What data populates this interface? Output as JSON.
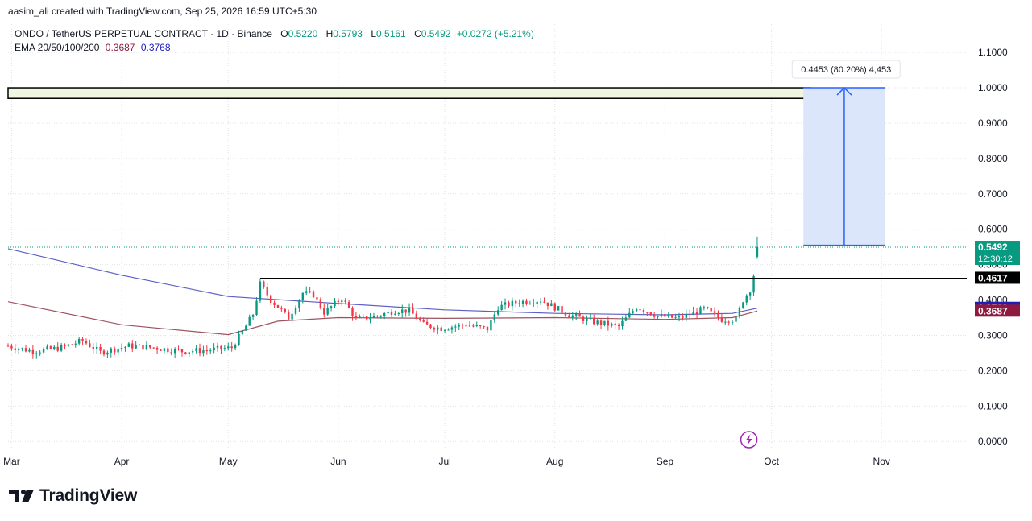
{
  "header": {
    "credit": "aasim_ali created with TradingView.com, Sep 25, 2026 16:59 UTC+5:30"
  },
  "legend": {
    "symbol": "ONDO / TetherUS PERPETUAL CONTRACT · 1D · Binance",
    "open_label": "O",
    "open": "0.5220",
    "high_label": "H",
    "high": "0.5793",
    "low_label": "L",
    "low": "0.5161",
    "close_label": "C",
    "close": "0.5492",
    "change": "+0.0272 (+5.21%)",
    "ema_label": "EMA 20/50/100/200",
    "ema1": "0.3687",
    "ema2": "0.3768"
  },
  "brand": {
    "name": "TradingView"
  },
  "colors": {
    "up": "#089981",
    "down": "#f23645",
    "ema_blue": "#5b5fc7",
    "ema_maroon": "#9c5461",
    "measure_fill": "#dbe6fb",
    "measure_line": "#2962ff",
    "zone_fill": "#eff7e1",
    "grid": "#e0e3eb"
  },
  "chart_data": {
    "type": "candlestick",
    "symbol": "ONDO / TetherUS PERPETUAL CONTRACT",
    "interval": "1D",
    "exchange": "Binance",
    "y_axis_side": "right",
    "ylim": [
      -0.02,
      1.18
    ],
    "y_ticks": [
      "1.1000",
      "1.0000",
      "0.9000",
      "0.8000",
      "0.7000",
      "0.6000",
      "0.5000",
      "0.4000",
      "0.3000",
      "0.2000",
      "0.1000",
      "0.0000"
    ],
    "x_ticks": [
      {
        "label": "Mar",
        "date": "2026-03-01"
      },
      {
        "label": "Apr",
        "date": "2026-04-01"
      },
      {
        "label": "May",
        "date": "2026-05-01"
      },
      {
        "label": "Jun",
        "date": "2026-06-01"
      },
      {
        "label": "Jul",
        "date": "2026-07-01"
      },
      {
        "label": "Aug",
        "date": "2026-08-01"
      },
      {
        "label": "Sep",
        "date": "2026-09-01"
      },
      {
        "label": "Oct",
        "date": "2026-10-01"
      },
      {
        "label": "Nov",
        "date": "2026-11-01"
      }
    ],
    "xlim": [
      "2026-02-28",
      "2026-11-25"
    ],
    "price_path": [
      [
        "2026-02-28",
        0.27
      ],
      [
        "2026-03-07",
        0.255
      ],
      [
        "2026-03-15",
        0.265
      ],
      [
        "2026-03-21",
        0.285
      ],
      [
        "2026-03-26",
        0.252
      ],
      [
        "2026-04-03",
        0.27
      ],
      [
        "2026-04-10",
        0.265
      ],
      [
        "2026-04-18",
        0.255
      ],
      [
        "2026-04-25",
        0.258
      ],
      [
        "2026-05-02",
        0.265
      ],
      [
        "2026-05-05",
        0.31
      ],
      [
        "2026-05-08",
        0.36
      ],
      [
        "2026-05-10",
        0.445
      ],
      [
        "2026-05-13",
        0.4
      ],
      [
        "2026-05-18",
        0.35
      ],
      [
        "2026-05-22",
        0.42
      ],
      [
        "2026-05-25",
        0.415
      ],
      [
        "2026-05-28",
        0.365
      ],
      [
        "2026-06-02",
        0.405
      ],
      [
        "2026-06-06",
        0.345
      ],
      [
        "2026-06-12",
        0.355
      ],
      [
        "2026-06-17",
        0.37
      ],
      [
        "2026-06-21",
        0.37
      ],
      [
        "2026-06-25",
        0.33
      ],
      [
        "2026-06-30",
        0.32
      ],
      [
        "2026-07-07",
        0.33
      ],
      [
        "2026-07-13",
        0.318
      ],
      [
        "2026-07-16",
        0.38
      ],
      [
        "2026-07-22",
        0.395
      ],
      [
        "2026-07-28",
        0.4
      ],
      [
        "2026-08-05",
        0.358
      ],
      [
        "2026-08-12",
        0.338
      ],
      [
        "2026-08-19",
        0.325
      ],
      [
        "2026-08-24",
        0.38
      ],
      [
        "2026-08-30",
        0.355
      ],
      [
        "2026-09-05",
        0.348
      ],
      [
        "2026-09-12",
        0.375
      ],
      [
        "2026-09-17",
        0.345
      ],
      [
        "2026-09-21",
        0.345
      ],
      [
        "2026-09-23",
        0.4
      ],
      [
        "2026-09-25",
        0.43
      ],
      [
        "2026-09-26",
        0.47
      ],
      [
        "2026-09-27",
        0.549
      ]
    ],
    "series": [
      {
        "type": "ema",
        "points": [
          [
            "2026-02-28",
            0.545
          ],
          [
            "2026-04-01",
            0.47
          ],
          [
            "2026-05-01",
            0.41
          ],
          [
            "2026-06-01",
            0.39
          ],
          [
            "2026-07-01",
            0.372
          ],
          [
            "2026-08-01",
            0.362
          ],
          [
            "2026-09-01",
            0.358
          ],
          [
            "2026-09-20",
            0.362
          ],
          [
            "2026-09-27",
            0.3768
          ]
        ]
      },
      {
        "type": "ema",
        "points": [
          [
            "2026-02-28",
            0.395
          ],
          [
            "2026-04-01",
            0.33
          ],
          [
            "2026-05-01",
            0.302
          ],
          [
            "2026-05-15",
            0.34
          ],
          [
            "2026-06-01",
            0.35
          ],
          [
            "2026-07-01",
            0.348
          ],
          [
            "2026-08-01",
            0.35
          ],
          [
            "2026-09-01",
            0.345
          ],
          [
            "2026-09-20",
            0.35
          ],
          [
            "2026-09-27",
            0.3687
          ]
        ]
      }
    ],
    "horizontal_lines": [
      {
        "price": 0.4617,
        "from": "2026-05-10"
      }
    ],
    "resistance_zone": {
      "from": "2026-02-28",
      "to": "2026-10-12",
      "low": 0.97,
      "high": 1.0
    },
    "price_range_tool": {
      "from": "2026-10-10",
      "to": "2026-11-02",
      "start_price": 0.5547,
      "end_price": 1.0,
      "label": "0.4453 (80.20%) 4,453"
    },
    "price_labels": [
      {
        "text": "0.5492",
        "sub": "12:30:12",
        "price": 0.5492,
        "color": "#089981"
      },
      {
        "text": "0.4617",
        "price": 0.4617,
        "color": "#000000"
      },
      {
        "text": "0.3768",
        "price": 0.3768,
        "color": "#1f1cb8"
      },
      {
        "text": "0.3687",
        "price": 0.3687,
        "color": "#8e1b3f"
      }
    ],
    "last_price_line": 0.5492,
    "event_marker": {
      "date": "2026-10-01",
      "icon": "lightning-icon"
    }
  }
}
